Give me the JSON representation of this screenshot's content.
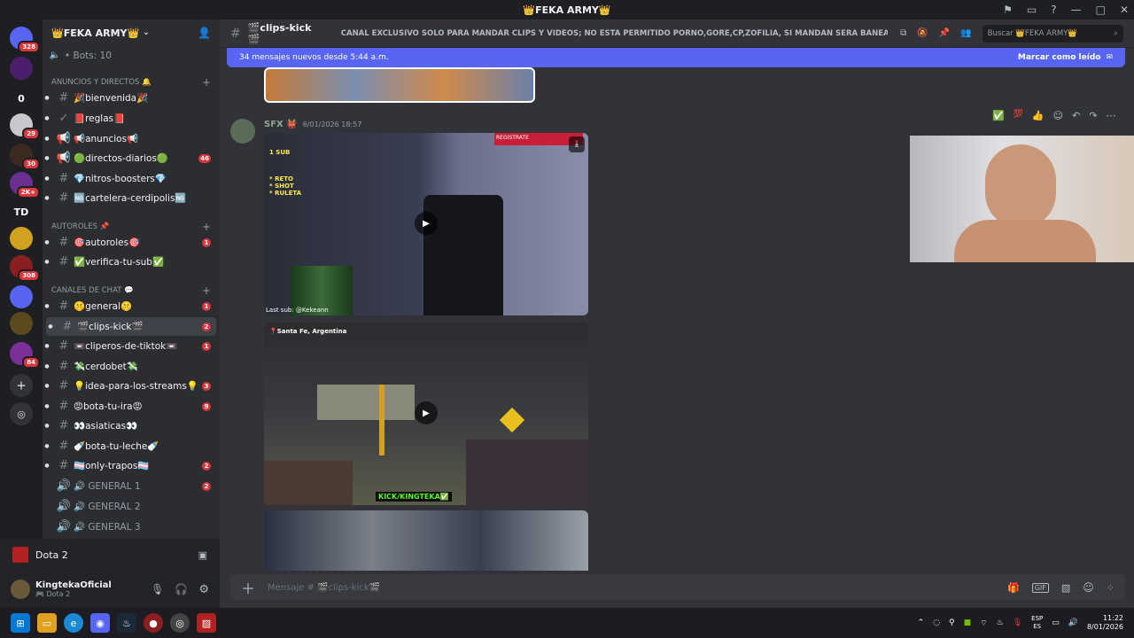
{
  "window": {
    "title": "👑FEKA ARMY👑"
  },
  "server_list": {
    "items": [
      {
        "label": "",
        "badge": "328",
        "color": "#5865f2"
      },
      {
        "label": "",
        "badge": "",
        "color": "#4a1e6b"
      },
      {
        "label": "0",
        "badge": "",
        "color": "#1e1f22"
      },
      {
        "label": "",
        "badge": "29",
        "color": "#c6c8cc"
      },
      {
        "label": "",
        "badge": "30",
        "color": "#3b2a20"
      },
      {
        "label": "",
        "badge": "2K+",
        "color": "#6b2f8f"
      },
      {
        "label": "TD",
        "badge": "",
        "color": "#1e1f22"
      },
      {
        "label": "",
        "badge": "",
        "color": "#d2a11f"
      },
      {
        "label": "",
        "badge": "308",
        "color": "#8b1e1e"
      },
      {
        "label": "",
        "badge": "",
        "color": "#5865f2"
      },
      {
        "label": "",
        "badge": "",
        "color": "#5c4a1e"
      },
      {
        "label": "",
        "badge": "84",
        "color": "#7b2f9b"
      }
    ]
  },
  "sidebar": {
    "server_name": "👑FEKA ARMY👑",
    "bots": "• Bots: 10",
    "categories": {
      "announcements": "ANUNCIOS Y DIRECTOS 🔔",
      "autoroles": "AUTOROLES 📌",
      "chat": "CANALES DE CHAT 💬"
    },
    "channels": [
      {
        "label": "🎉bienvenida🎉",
        "icon": "#",
        "count": "",
        "bold": true
      },
      {
        "label": "📕reglas📕",
        "icon": "✓",
        "count": "",
        "bold": true
      },
      {
        "label": "📢anuncios📢",
        "icon": "📢",
        "count": "",
        "bold": true
      },
      {
        "label": "🟢directos-diarios🟢",
        "icon": "📢",
        "count": "46",
        "bold": true
      },
      {
        "label": "💎nitros-boosters💎",
        "icon": "#",
        "count": "",
        "bold": true
      },
      {
        "label": "🆖cartelera-cerdipolis🆖",
        "icon": "#",
        "count": "",
        "bold": true
      },
      {
        "label": "🎯autoroles🎯",
        "icon": "#",
        "count": "1",
        "bold": true
      },
      {
        "label": "✅verifica-tu-sub✅",
        "icon": "#",
        "count": "",
        "bold": true
      },
      {
        "label": "🤫general🤫",
        "icon": "#",
        "count": "1",
        "bold": true
      },
      {
        "label": "🎬clips-kick🎬",
        "icon": "#",
        "count": "2",
        "bold": true
      },
      {
        "label": "📼cliperos-de-tiktok📼",
        "icon": "#",
        "count": "1",
        "bold": true
      },
      {
        "label": "💸cerdobet💸",
        "icon": "#",
        "count": "",
        "bold": true
      },
      {
        "label": "💡idea-para-los-streams💡",
        "icon": "#",
        "count": "3",
        "bold": true
      },
      {
        "label": "😡bota-tu-ira😡",
        "icon": "#",
        "count": "9",
        "bold": true
      },
      {
        "label": "👀asiaticas👀",
        "icon": "#",
        "count": "",
        "bold": true
      },
      {
        "label": "🍼bota-tu-leche🍼",
        "icon": "#",
        "count": "",
        "bold": true
      },
      {
        "label": "🏳️‍⚧️only-trapos🏳️‍⚧️",
        "icon": "#",
        "count": "2",
        "bold": true
      },
      {
        "label": "🔊 GENERAL 1",
        "icon": "🔊",
        "count": "2",
        "bold": false
      },
      {
        "label": "🔊 GENERAL 2",
        "icon": "🔊",
        "count": "",
        "bold": false
      },
      {
        "label": "🔊 GENERAL 3",
        "icon": "🔊",
        "count": "",
        "bold": false
      }
    ]
  },
  "voice": {
    "label": "Dota 2"
  },
  "user": {
    "name": "KingtekaOficial",
    "status": "🎮 Dota 2"
  },
  "channel_header": {
    "name": "🎬clips-kick🎬",
    "topic": "CANAL EXCLUSIVO SOLO PARA MANDAR CLIPS Y VIDEOS; NO ESTA PERMITIDO PORNO,GORE,CP,ZOFILIA, SI MANDAN SERA BANEADO PERMA...",
    "search_placeholder": "Buscar 👑FEKA ARMY👑"
  },
  "new_messages": {
    "text": "34 mensajes nuevos desde 5:44 a.m.",
    "mark_read": "Marcar como leído"
  },
  "message": {
    "author": "SFX 👹",
    "timestamp": "6/01/2026 18:57",
    "video1": {
      "overlay_top": "1 SUB",
      "overlay_list": "* RETO\n* SHOT\n* RULETA",
      "overlay_bottom": "Last sub: @Kekeann",
      "label_brand": "REGISTRATE"
    },
    "video2": {
      "location": "📍Santa Fe, Argentina",
      "brand": "KICK/KINGTEKA✅"
    }
  },
  "composer": {
    "placeholder": "Mensaje # 🎬clips-kick🎬"
  },
  "taskbar": {
    "lang1": "ESP",
    "lang2": "ES",
    "time": "11:22",
    "date": "8/01/2026"
  }
}
